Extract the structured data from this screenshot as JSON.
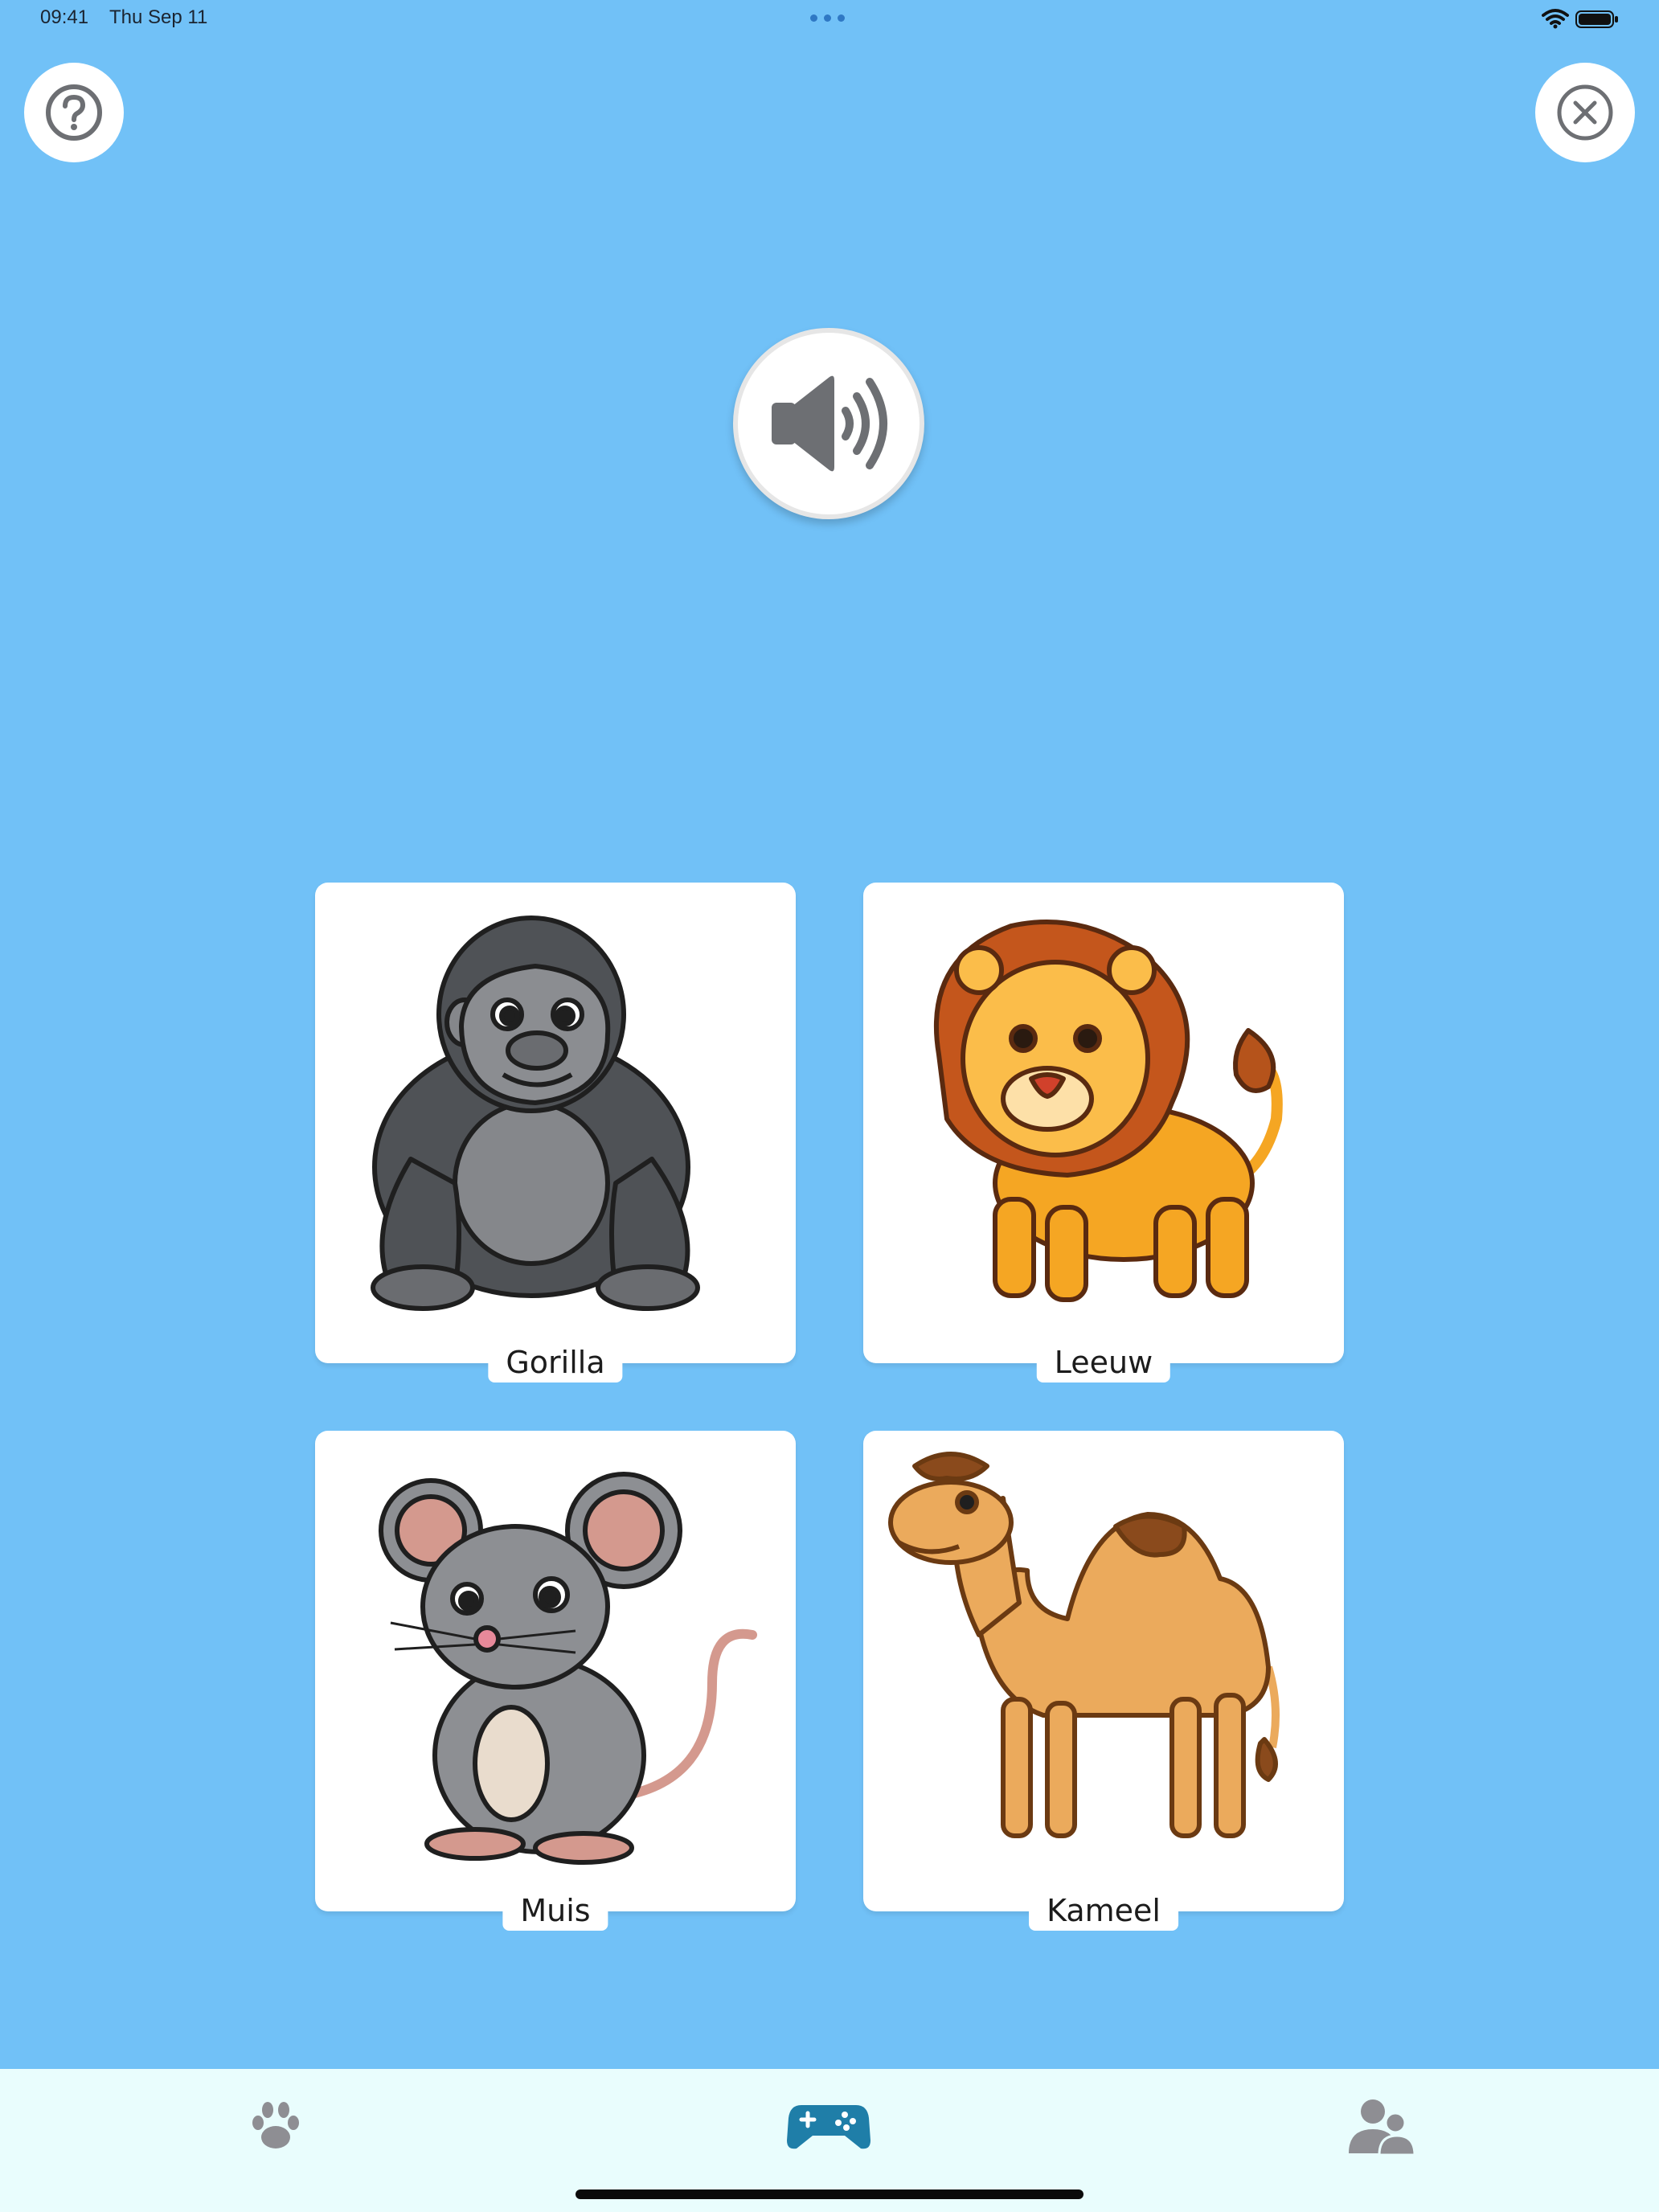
{
  "status_bar": {
    "time": "09:41",
    "date": "Thu Sep 11"
  },
  "header": {
    "help_icon": "question-mark-circle",
    "close_icon": "close-x-circle"
  },
  "sound": {
    "icon": "speaker-wave"
  },
  "cards": [
    {
      "label": "Gorilla",
      "icon": "gorilla-illustration"
    },
    {
      "label": "Leeuw",
      "icon": "lion-illustration"
    },
    {
      "label": "Muis",
      "icon": "mouse-illustration"
    },
    {
      "label": "Kameel",
      "icon": "camel-illustration"
    }
  ],
  "tab_bar": {
    "items": [
      {
        "icon": "paw-icon",
        "selected": false
      },
      {
        "icon": "gamepad-icon",
        "selected": true
      },
      {
        "icon": "users-icon",
        "selected": false
      }
    ],
    "colors": {
      "selected": "#1f7ea8",
      "unselected": "#8e8e93"
    }
  },
  "colors": {
    "background": "#71c1f7",
    "tab_bar": "#e9fdfd",
    "icon_gray": "#6d6f73"
  }
}
